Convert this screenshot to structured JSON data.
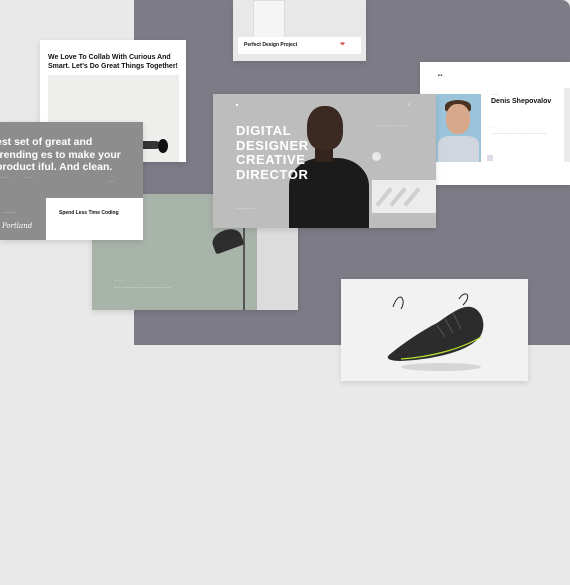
{
  "collab_card": {
    "heading": "We Love To Collab With Curious And Smart. Let's Do Great Things Together!"
  },
  "trending_card": {
    "heading": "est set of great and trending es to make your product iful. And clean.",
    "spend_label": "Spend Less Time Coding",
    "signature": "Portland"
  },
  "project_card": {
    "title": "Perfect Design Project"
  },
  "profile_card": {
    "name": "Denis Shepovalov"
  },
  "hero_card": {
    "headline": "DIGITAL DESIGNER CREATIVE DIRECTOR"
  },
  "icons": [
    "heart-icon",
    "play-icon",
    "menu-icon",
    "shoe-image"
  ],
  "colors": {
    "backdrop": "#7d7b86",
    "page": "#e9e9e9",
    "heart": "#e05a5a",
    "green_card": "#a8b3aa"
  }
}
